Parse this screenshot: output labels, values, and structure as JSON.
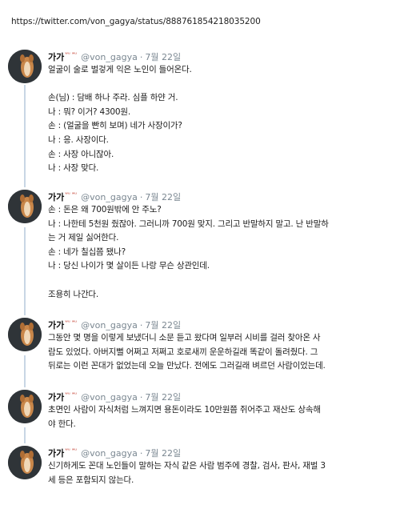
{
  "url_bar": {
    "text": "https://twitter.com/von_gagya/status/888761854218035200"
  },
  "author": {
    "name": "가가",
    "emoji1": "ʷᵘ",
    "emoji2": "ʷᵘ",
    "handle": "@von_gagya",
    "separator": "·"
  },
  "tweets": [
    {
      "date": "7월 22일",
      "lines": [
        "얼굴이 술로 벌겋게 익은 노인이 들어온다.",
        "",
        "손(님) : 담배 하나 주라. 심플 하얀 거.",
        "나 : 뭐? 이거? 4300원.",
        "손 : (얼굴을 빤히 보며) 네가 사장이가?",
        "나 : 응. 사장이다.",
        "손 : 사장 아니잖아.",
        "나 : 사장 맞다."
      ]
    },
    {
      "date": "7월 22일",
      "lines": [
        "손 : 돈은 왜 700원밖에 안 주노?",
        "나 : 나한테 5천원 줬잖아. 그러니까 700원 맞지. 그리고 반말하지 말고. 난 반말하",
        "는 거 제일 싫어한다.",
        "손 : 네가 칠십쯤 됐나?",
        "나 : 당신 나이가 몇 살이든 나랑 무슨 상관인데.",
        "",
        "조용히 나간다."
      ]
    },
    {
      "date": "7월 22일",
      "lines": [
        "그동안 몇 명을 이렇게 보냈더니 소문 듣고 왔다며 일부러 시비를 걸러 찾아온 사",
        "람도 있었다. 아버지뻘 어쩌고 저쩌고 호로새끼 운운하길래 똑같이 돌려줬다. 그",
        "뒤로는 이런 꼰대가 없었는데 오늘 만났다. 전에도 그러길래 벼르던 사람이었는데."
      ]
    },
    {
      "date": "7월 22일",
      "lines": [
        "초면인 사람이 자식처럼 느껴지면 용돈이라도 10만원쯤 쥐어주고 재산도 상속해",
        "야 한다."
      ]
    },
    {
      "date": "7월 22일",
      "lines": [
        "신기하게도 꼰대 노인들이 말하는 자식 같은 사람 범주에 경찰, 검사, 판사, 재벌 3",
        "세 등은 포함되지 않는다."
      ]
    }
  ]
}
